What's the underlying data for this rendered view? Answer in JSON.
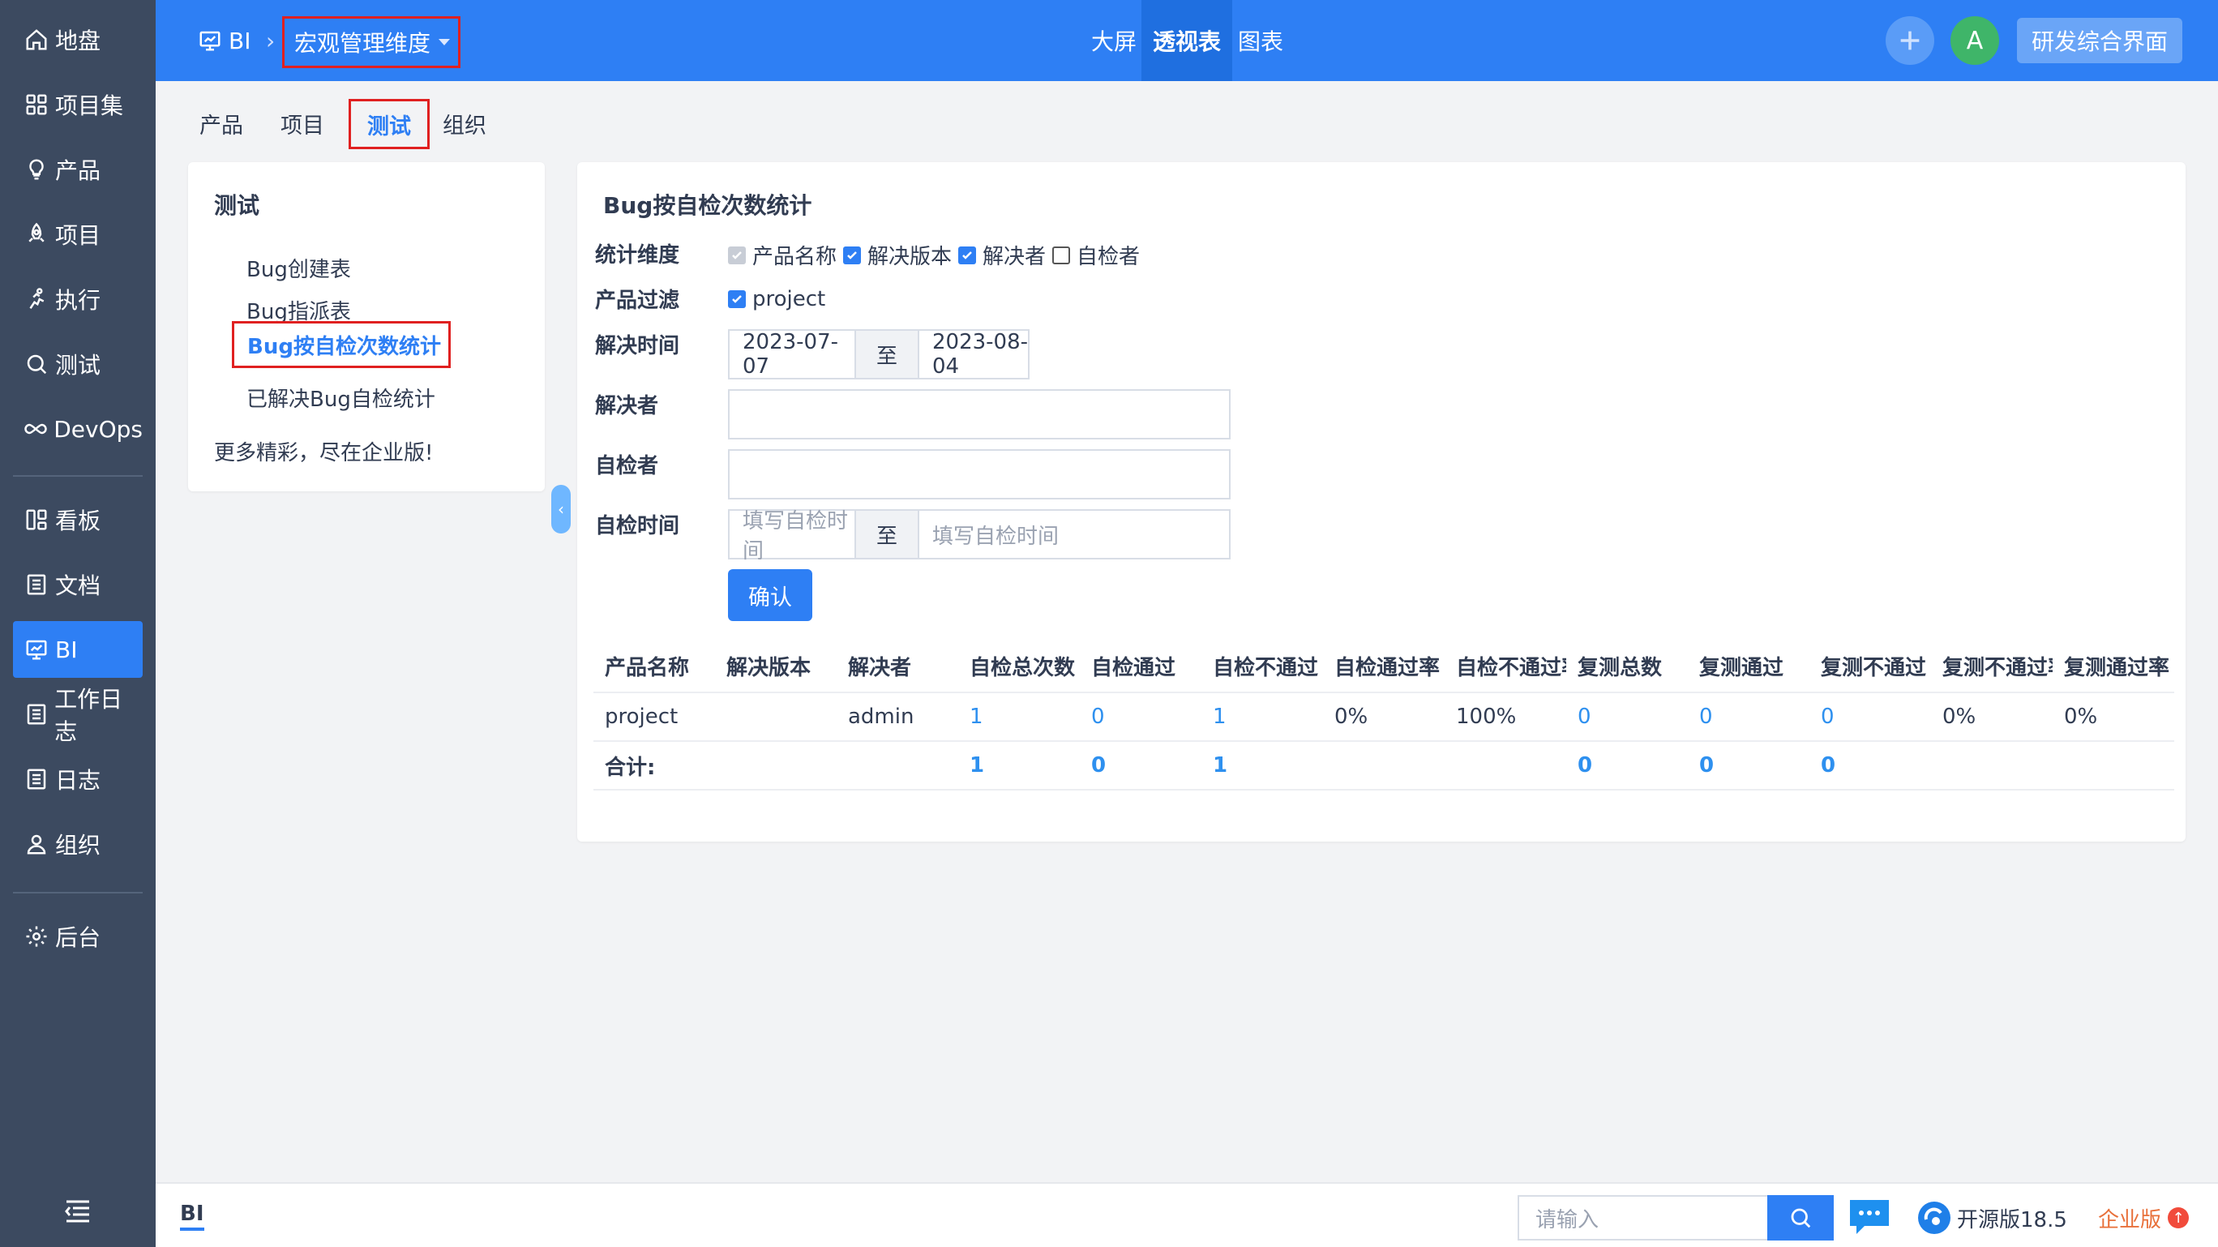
{
  "sidebar": {
    "items": [
      {
        "label": "地盘",
        "icon": "home-icon"
      },
      {
        "label": "项目集",
        "icon": "grid-icon"
      },
      {
        "label": "产品",
        "icon": "lightbulb-icon"
      },
      {
        "label": "项目",
        "icon": "rocket-icon"
      },
      {
        "label": "执行",
        "icon": "run-icon"
      },
      {
        "label": "测试",
        "icon": "search-icon"
      },
      {
        "label": "DevOps",
        "icon": "infinity-icon"
      },
      {
        "label": "看板",
        "icon": "kanban-icon"
      },
      {
        "label": "文档",
        "icon": "doc-icon"
      },
      {
        "label": "BI",
        "icon": "monitor-icon"
      },
      {
        "label": "工作日志",
        "icon": "list-icon"
      },
      {
        "label": "日志",
        "icon": "list-icon"
      },
      {
        "label": "组织",
        "icon": "user-icon"
      },
      {
        "label": "后台",
        "icon": "gear-icon"
      }
    ],
    "active": "BI"
  },
  "header": {
    "crumb": "BI",
    "dimension": "宏观管理维度",
    "nav": [
      "大屏",
      "透视表",
      "图表"
    ],
    "active_nav": "透视表",
    "avatar_letter": "A",
    "workspace": "研发综合界面"
  },
  "subtabs": [
    "产品",
    "项目",
    "测试",
    "组织"
  ],
  "active_subtab": "测试",
  "left_panel": {
    "title": "测试",
    "reports": [
      "Bug创建表",
      "Bug指派表",
      "Bug按自检次数统计",
      "已解决Bug自检统计"
    ],
    "more": "更多精彩，尽在企业版!"
  },
  "report": {
    "title": "Bug按自检次数统计",
    "labels": {
      "dimension": "统计维度",
      "product_filter": "产品过滤",
      "resolve_time": "解决时间",
      "resolver": "解决者",
      "checker": "自检者",
      "check_time": "自检时间"
    },
    "dimension_options": [
      {
        "label": "产品名称",
        "state": "disabled"
      },
      {
        "label": "解决版本",
        "state": "on"
      },
      {
        "label": "解决者",
        "state": "on"
      },
      {
        "label": "自检者",
        "state": "off"
      }
    ],
    "product_filter_option": "project",
    "resolve_from": "2023-07-07",
    "range_sep": "至",
    "resolve_to": "2023-08-04",
    "resolver_value": "",
    "checker_value": "",
    "check_time_placeholder": "填写自检时间",
    "confirm": "确认"
  },
  "table": {
    "headers": [
      "产品名称",
      "解决版本",
      "解决者",
      "自检总次数",
      "自检通过",
      "自检不通过",
      "自检通过率",
      "自检不通过率",
      "复测总数",
      "复测通过",
      "复测不通过",
      "复测不通过率",
      "复测通过率"
    ],
    "row": [
      "project",
      "",
      "admin",
      "1",
      "0",
      "1",
      "0%",
      "100%",
      "0",
      "0",
      "0",
      "0%",
      "0%"
    ],
    "total": [
      "合计:",
      "",
      "",
      "1",
      "0",
      "1",
      "",
      "",
      "0",
      "0",
      "0",
      "",
      ""
    ]
  },
  "footer": {
    "tab": "BI",
    "search_placeholder": "请输入",
    "edition": "开源版18.5",
    "enterprise": "企业版"
  },
  "colors": {
    "primary": "#2e7ff4",
    "sidebar": "#3c4a60",
    "highlight_box": "#e02020",
    "link": "#2e90ef"
  }
}
